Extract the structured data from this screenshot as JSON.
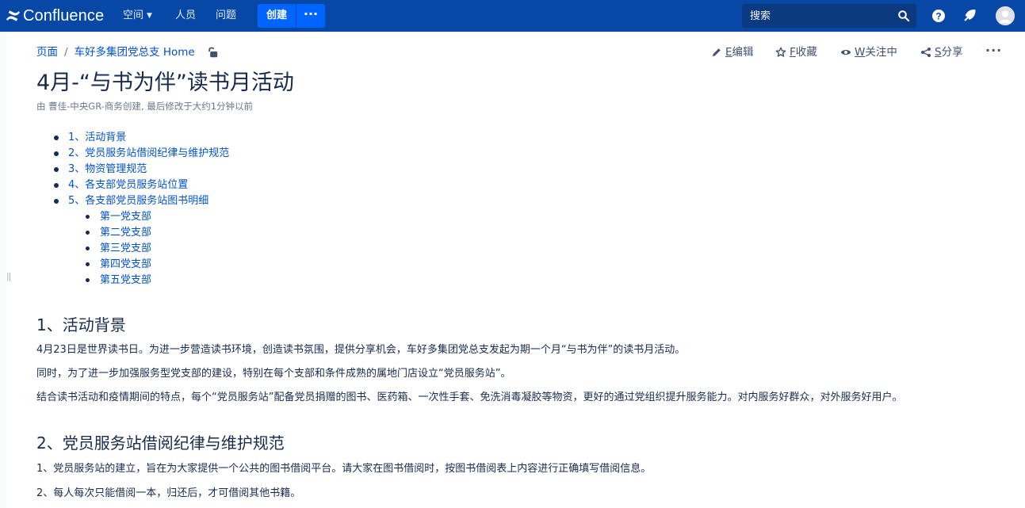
{
  "topnav": {
    "brand": "Confluence",
    "spaces": "空间",
    "people": "人员",
    "questions": "问题",
    "create": "创建",
    "more": "···",
    "search_placeholder": "搜索"
  },
  "breadcrumb": {
    "items": [
      "页面",
      "车好多集团党总支 Home"
    ],
    "separator": "/"
  },
  "actions": {
    "edit_key": "E",
    "edit": "编辑",
    "star_key": "F",
    "star": "收藏",
    "watch_key": "W",
    "watch": "关注中",
    "share_key": "S",
    "share": "分享",
    "more": "···"
  },
  "page": {
    "title": "4月-“与书为伴”读书月活动",
    "byline": "由 曹佳-中央GR-商务创建, 最后修改于大约1分钟以前"
  },
  "toc": {
    "items": [
      "1、活动背景",
      "2、党员服务站借阅纪律与维护规范",
      "3、物资管理规范",
      "4、各支部党员服务站位置",
      "5、各支部党员服务站图书明细"
    ],
    "subitems": [
      "第一党支部",
      "第二党支部",
      "第三党支部",
      "第四党支部",
      "第五党支部"
    ]
  },
  "sections": [
    {
      "heading": "1、活动背景",
      "paragraphs": [
        "4月23日是世界读书日。为进一步营造读书环境，创造读书氛围，提供分享机会，车好多集团党总支发起为期一个月“与书为伴”的读书月活动。",
        "同时，为了进一步加强服务型党支部的建设，特别在每个支部和条件成熟的属地门店设立“党员服务站”。",
        "结合读书活动和疫情期间的特点，每个“党员服务站”配备党员捐赠的图书、医药箱、一次性手套、免洗消毒凝胶等物资，更好的通过党组织提升服务能力。对内服务好群众，对外服务好用户。"
      ]
    },
    {
      "heading": "2、党员服务站借阅纪律与维护规范",
      "paragraphs": [
        "1、党员服务站的建立，旨在为大家提供一个公共的图书借阅平台。请大家在图书借阅时，按图书借阅表上内容进行正确填写借阅信息。",
        "2、每人每次只能借阅一本，归还后，才可借阅其他书籍。"
      ]
    }
  ],
  "colors": {
    "topbar": "#0747a6",
    "button": "#0065ff",
    "link": "#0052cc",
    "text": "#172b4d"
  }
}
